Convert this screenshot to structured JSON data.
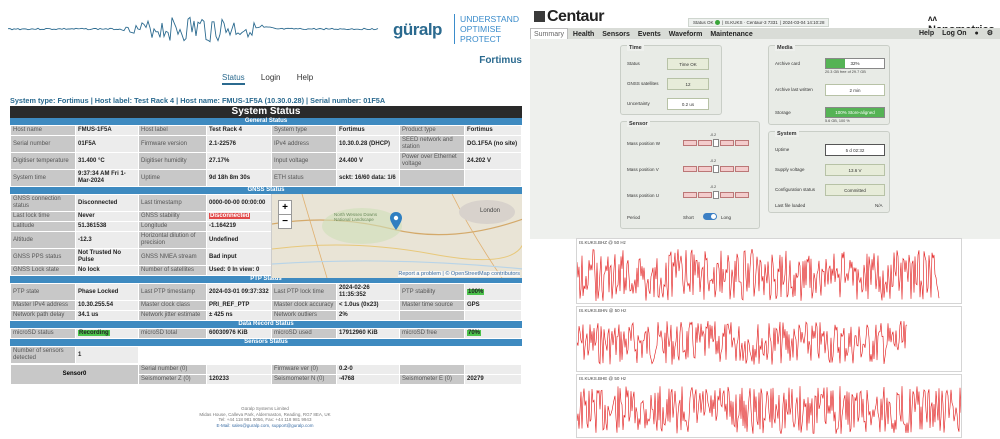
{
  "left": {
    "brand": "güralp",
    "tagline": [
      "UNDERSTAND",
      "OPTIMISE",
      "PROTECT"
    ],
    "site": "Fortimus",
    "nav": [
      {
        "label": "Status",
        "active": true
      },
      {
        "label": "Login",
        "active": false
      },
      {
        "label": "Help",
        "active": false
      }
    ],
    "sysline": "System type: Fortimus | Host label: Test Rack 4 | Host name: FMUS-1F5A (10.30.0.28) | Serial number: 01F5A",
    "title": "System Status",
    "general_title": "General Status",
    "general": [
      [
        "Host name",
        "FMUS-1F5A",
        "Host label",
        "Test Rack 4",
        "System type",
        "Fortimus",
        "Product type",
        "Fortimus"
      ],
      [
        "Serial number",
        "01F5A",
        "Firmware version",
        "2.1-22576",
        "IPv4 address",
        "10.30.0.28 (DHCP)",
        "SEED network and station",
        "DG.1F5A (no site)"
      ],
      [
        "Digitiser temperature",
        "31.400 °C",
        "Digitiser humidity",
        "27.17%",
        "Input voltage",
        "24.400 V",
        "Power over Ethernet voltage",
        "24.202 V"
      ],
      [
        "System time",
        "9:37:34 AM Fri 1-Mar-2024",
        "Uptime",
        "9d 18h 8m 30s",
        "ETH status",
        "sckt: 16/60 data: 1/6",
        "",
        ""
      ]
    ],
    "gnss_title": "GNSS Status",
    "gnss": [
      [
        "GNSS connection status",
        "Disconnected",
        "Last timestamp",
        "0000-00-00 00:00:00"
      ],
      [
        "Last lock time",
        "Never",
        "GNSS stability",
        "Disconnected"
      ],
      [
        "Latitude",
        "51.361538",
        "Longitude",
        "-1.164219"
      ],
      [
        "Altitude",
        "-12.3",
        "Horizontal dilution of precision",
        "Undefined"
      ],
      [
        "GNSS PPS status",
        "Not Trusted No Pulse",
        "GNSS NMEA stream",
        "Bad input"
      ],
      [
        "GNSS Lock state",
        "No lock",
        "Number of satellites",
        "Used: 0 In view: 0"
      ]
    ],
    "map": {
      "zoom_in": "+",
      "zoom_out": "−",
      "place_labels": [
        "North Wessex Downs National Landscape",
        "London"
      ],
      "attribution": "Report a problem | © OpenStreetMap contributors"
    },
    "ptp_title": "PTP Status",
    "ptp": [
      [
        "PTP state",
        "Phase Locked",
        "Last PTP timestamp",
        "2024-03-01 09:37:332",
        "Last PTP lock time",
        "2024-02-26 11:35:352",
        "PTP stability",
        "100%"
      ],
      [
        "Master IPv4 address",
        "10.30.255.54",
        "Master clock class",
        "PRI_REF_PTP",
        "Master clock accuracy",
        "< 1.0us (0x23)",
        "Master time source",
        "GPS"
      ],
      [
        "Network path delay",
        "34.1 us",
        "Network jitter estimate",
        "± 425 ns",
        "Network outliers",
        "2%",
        "",
        ""
      ]
    ],
    "data_title": "Data Record Status",
    "data": [
      "microSD status",
      "Recording",
      "microSD total",
      "60030976 KiB",
      "microSD used",
      "17912960 KiB",
      "microSD free",
      "70%"
    ],
    "sensors_title": "Sensors Status",
    "sensors_count": [
      "Number of sensors detected",
      "1"
    ],
    "sensor0": {
      "name": "Sensor0",
      "rows": [
        [
          "Serial number (0)",
          "",
          "Firmware ver (0)",
          "0.2-0",
          "",
          ""
        ],
        [
          "Seismometer Z (0)",
          "120233",
          "Seismometer N (0)",
          "-4768",
          "Seismometer E (0)",
          "20279"
        ]
      ]
    },
    "footer": [
      "Güralp Systems Limited",
      "Midas House, Calleva Park, Aldermaston, Reading, RG7 8EA, UK",
      "Tel: +44 118 981 9056, Fax: +44 118 981 9943",
      "E-Mail: sales@guralp.com, support@guralp.com"
    ]
  },
  "right": {
    "logo": "Centaur",
    "status_text": "Status OK",
    "station": "IS.KUKS · Centaur-3 7331",
    "timestamp": "2024-03-04 14:10:28",
    "nano": "Nanometrics",
    "menu": [
      "Summary",
      "Health",
      "Sensors",
      "Events",
      "Waveform",
      "Maintenance"
    ],
    "menu_right": [
      "Help",
      "Log On"
    ],
    "time_card": {
      "title": "Time",
      "rows": [
        {
          "label": "Status",
          "value": "Time OK"
        },
        {
          "label": "GNSS satellites",
          "value": "12"
        },
        {
          "label": "Uncertainty",
          "value": "0.2 us"
        }
      ]
    },
    "media_card": {
      "title": "Media",
      "rows": [
        {
          "label": "Archive card",
          "value": "32%",
          "fraction": 0.32,
          "sub": "20.3 GB free of 29.7 GB"
        },
        {
          "label": "Archive last written",
          "value": "2 min"
        },
        {
          "label": "Storage",
          "value": "100% Store-aligned",
          "fraction": 1.0,
          "sub": "5.6 GB, 100 %"
        }
      ]
    },
    "sensor_card": {
      "title": "Sensor",
      "rows": [
        {
          "label": "Mass position W",
          "value": "-0.2"
        },
        {
          "label": "Mass position V",
          "value": "-0.2"
        },
        {
          "label": "Mass position U",
          "value": "-0.2"
        }
      ],
      "period_label": "Period",
      "period_options": [
        "Short",
        "Long"
      ]
    },
    "system_card": {
      "title": "System",
      "rows": [
        {
          "label": "Uptime",
          "value": "5 d 02:32"
        },
        {
          "label": "Supply voltage",
          "value": "13.6 V"
        },
        {
          "label": "Configuration status",
          "value": "Committed"
        },
        {
          "label": "Last file loaded",
          "value": "N/A"
        }
      ]
    },
    "waveforms": [
      "IS.KUKS.BHZ @ 50 Hz",
      "IS.KUKS.BHN @ 50 Hz",
      "IS.KUKS.BHE @ 50 Hz"
    ],
    "colors": {
      "wave": "#e01010",
      "accent": "#3b7fc4",
      "ok": "#55b355"
    }
  }
}
